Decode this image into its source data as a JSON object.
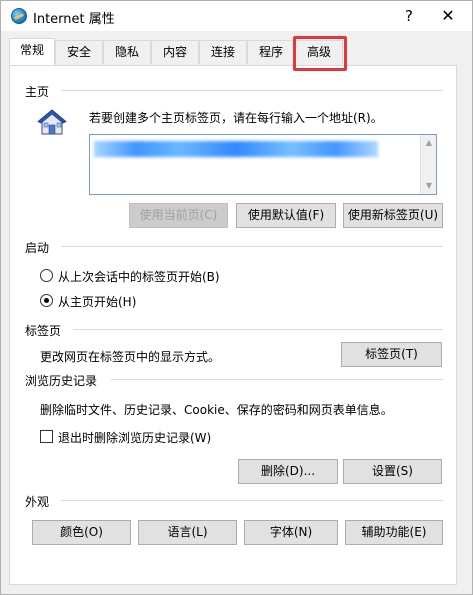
{
  "window": {
    "title": "Internet 属性",
    "help_label": "?",
    "close_label": "✕"
  },
  "tabs": [
    {
      "label": "常规",
      "active": true
    },
    {
      "label": "安全",
      "active": false
    },
    {
      "label": "隐私",
      "active": false
    },
    {
      "label": "内容",
      "active": false
    },
    {
      "label": "连接",
      "active": false
    },
    {
      "label": "程序",
      "active": false
    },
    {
      "label": "高级",
      "active": false,
      "highlighted": true
    }
  ],
  "home_page": {
    "section_label": "主页",
    "instruction": "若要创建多个主页标签页，请在每行输入一个地址(R)。",
    "url_value_obscured": true,
    "buttons": {
      "use_current": "使用当前页(C)",
      "use_default": "使用默认值(F)",
      "use_new_tab": "使用新标签页(U)"
    }
  },
  "startup": {
    "section_label": "启动",
    "option_last_session": "从上次会话中的标签页开始(B)",
    "option_home_page": "从主页开始(H)",
    "selected": "home_page"
  },
  "tabs_section": {
    "section_label": "标签页",
    "description": "更改网页在标签页中的显示方式。",
    "button": "标签页(T)"
  },
  "history": {
    "section_label": "浏览历史记录",
    "description": "删除临时文件、历史记录、Cookie、保存的密码和网页表单信息。",
    "checkbox_label": "退出时删除浏览历史记录(W)",
    "checkbox_checked": false,
    "delete_button": "删除(D)...",
    "settings_button": "设置(S)"
  },
  "appearance": {
    "section_label": "外观",
    "colors_button": "颜色(O)",
    "languages_button": "语言(L)",
    "fonts_button": "字体(N)",
    "accessibility_button": "辅助功能(E)"
  },
  "colors": {
    "highlight": "#e0383b",
    "window_bg": "#f0f0f0",
    "panel_bg": "#ffffff",
    "url_border": "#7a9cc7",
    "disabled_text": "#a0a0a0"
  }
}
